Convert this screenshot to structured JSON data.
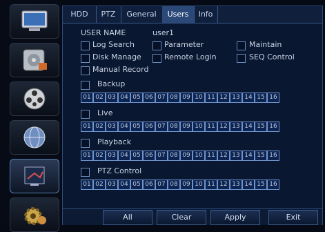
{
  "tabs": [
    "HDD",
    "PTZ",
    "General",
    "Users",
    "Info"
  ],
  "user": {
    "label": "USER NAME",
    "value": "user1"
  },
  "permissions": [
    {
      "label": "Log Search"
    },
    {
      "label": "Parameter"
    },
    {
      "label": "Maintain"
    },
    {
      "label": "Disk Manage"
    },
    {
      "label": "Remote Login"
    },
    {
      "label": "SEQ Control"
    },
    {
      "label": "Manual Record"
    }
  ],
  "sections": [
    {
      "label": "Backup"
    },
    {
      "label": "Live"
    },
    {
      "label": "Playback"
    },
    {
      "label": "PTZ Control"
    }
  ],
  "channels": [
    "01",
    "02",
    "03",
    "04",
    "05",
    "06",
    "07",
    "08",
    "09",
    "10",
    "11",
    "12",
    "13",
    "14",
    "15",
    "16"
  ],
  "buttons": {
    "all": "All",
    "clear": "Clear",
    "apply": "Apply",
    "exit": "Exit"
  },
  "sidebar": [
    "monitor-icon",
    "disk-icon",
    "film-reel-icon",
    "globe-icon",
    "user-settings-icon",
    "gear-icon"
  ]
}
